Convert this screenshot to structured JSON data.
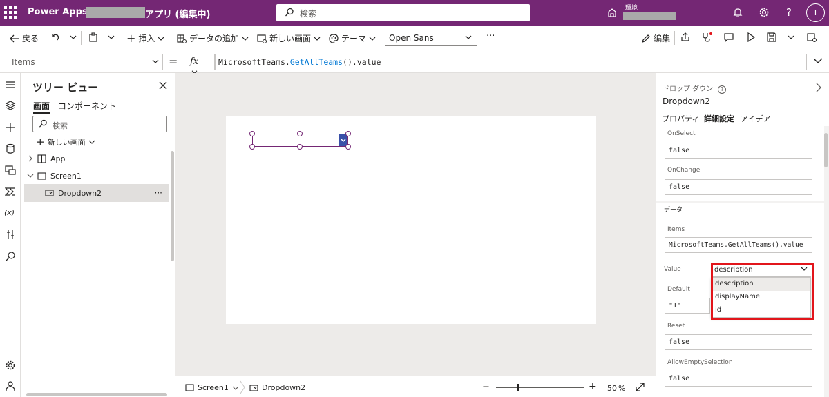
{
  "header": {
    "brand": "Power Apps",
    "separator": "|",
    "app_name": "アプリ (編集中)",
    "search_placeholder": "検索",
    "env_label": "環境",
    "avatar_initial": "T"
  },
  "commands": {
    "back": "戻る",
    "insert": "挿入",
    "add_data": "データの追加",
    "new_screen": "新しい画面",
    "theme": "テーマ",
    "font": "Open Sans",
    "more": "···",
    "edit": "編集"
  },
  "formula_bar": {
    "property": "Items",
    "equals": "=",
    "fx": "fx",
    "formula_prefix": "MicrosoftTeams.",
    "formula_fn": "GetAllTeams",
    "formula_suffix": "().value"
  },
  "tree": {
    "title": "ツリー ビュー",
    "tabs": [
      "画面",
      "コンポーネント"
    ],
    "search_placeholder": "検索",
    "new_screen": "新しい画面",
    "items": [
      {
        "label": "App"
      },
      {
        "label": "Screen1"
      },
      {
        "label": "Dropdown2"
      }
    ],
    "more": "···"
  },
  "status": {
    "screen": "Screen1",
    "control": "Dropdown2",
    "zoom_minus": "−",
    "zoom_plus": "+",
    "zoom": "50",
    "zoom_unit": "%"
  },
  "properties": {
    "control_type": "ドロップ ダウン",
    "control_name": "Dropdown2",
    "tabs": [
      "プロパティ",
      "詳細設定",
      "アイデア"
    ],
    "on_select_label": "OnSelect",
    "on_select_value": "false",
    "on_change_label": "OnChange",
    "on_change_value": "false",
    "data_section": "データ",
    "items_label": "Items",
    "items_value": "MicrosoftTeams.GetAllTeams().value",
    "value_label": "Value",
    "value_selected": "description",
    "value_options": [
      "description",
      "displayName",
      "id"
    ],
    "default_label": "Default",
    "default_value": "\"1\"",
    "reset_label": "Reset",
    "reset_value": "false",
    "allow_empty_label": "AllowEmptySelection",
    "allow_empty_value": "false"
  },
  "colors": {
    "brand": "#742774",
    "highlight": "#e2151b",
    "dropdown_button": "#3a50a8"
  }
}
